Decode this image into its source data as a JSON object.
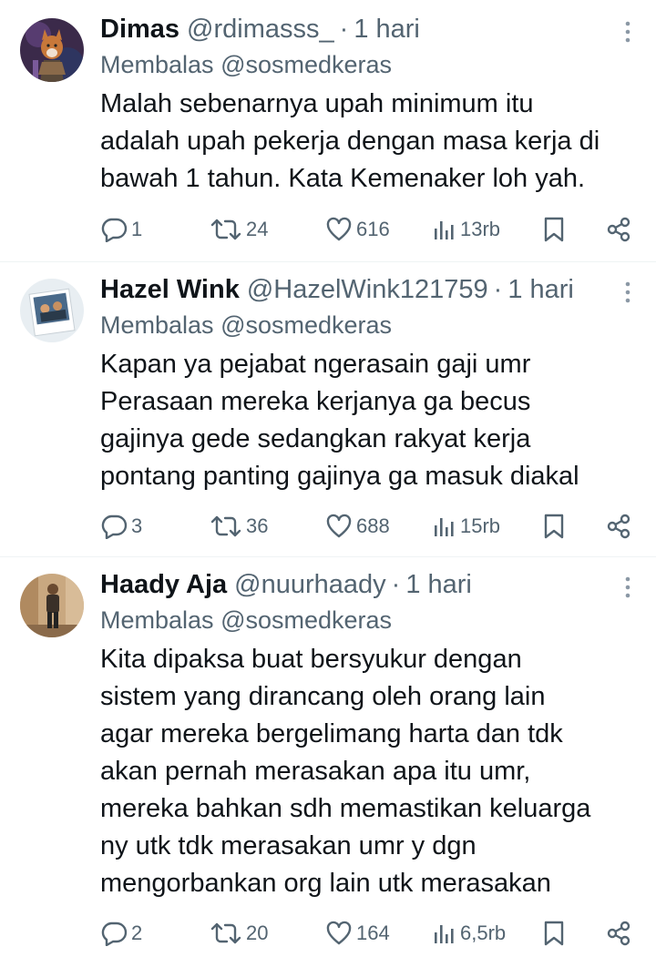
{
  "colors": {
    "text_primary": "#0f1419",
    "text_secondary": "#536471",
    "divider": "#eff3f4"
  },
  "tweets": [
    {
      "name": "Dimas",
      "handle": "@rdimasss_",
      "separator": "·",
      "time": "1 hari",
      "reply_prefix": "Membalas",
      "reply_to": "@sosmedkeras",
      "lines": [
        "Malah sebenarnya upah minimum itu",
        "adalah upah pekerja dengan masa kerja di",
        "bawah 1 tahun. Kata Kemenaker loh yah."
      ],
      "replies": "1",
      "reposts": "24",
      "likes": "616",
      "views": "13rb",
      "avatar_icon": "avatar-fox-warrior"
    },
    {
      "name": "Hazel Wink",
      "handle": "@HazelWink121759",
      "separator": "·",
      "time": "1 hari",
      "reply_prefix": "Membalas",
      "reply_to": "@sosmedkeras",
      "lines": [
        "Kapan ya pejabat ngerasain gaji umr",
        "Perasaan mereka kerjanya ga becus",
        "gajinya gede sedangkan rakyat kerja",
        "pontang panting gajinya ga masuk diakal"
      ],
      "replies": "3",
      "reposts": "36",
      "likes": "688",
      "views": "15rb",
      "avatar_icon": "avatar-polaroid-photo"
    },
    {
      "name": "Haady Aja",
      "handle": "@nuurhaady",
      "separator": "·",
      "time": "1 hari",
      "reply_prefix": "Membalas",
      "reply_to": "@sosmedkeras",
      "lines": [
        "Kita dipaksa buat bersyukur dengan",
        "sistem yang dirancang oleh orang lain",
        "agar mereka bergelimang harta dan tdk",
        "akan pernah merasakan apa itu umr,",
        "mereka bahkan sdh memastikan keluarga",
        "ny utk tdk merasakan umr y dgn",
        "mengorbankan org lain utk merasakan"
      ],
      "replies": "2",
      "reposts": "20",
      "likes": "164",
      "views": "6,5rb",
      "avatar_icon": "avatar-person-standing"
    }
  ]
}
